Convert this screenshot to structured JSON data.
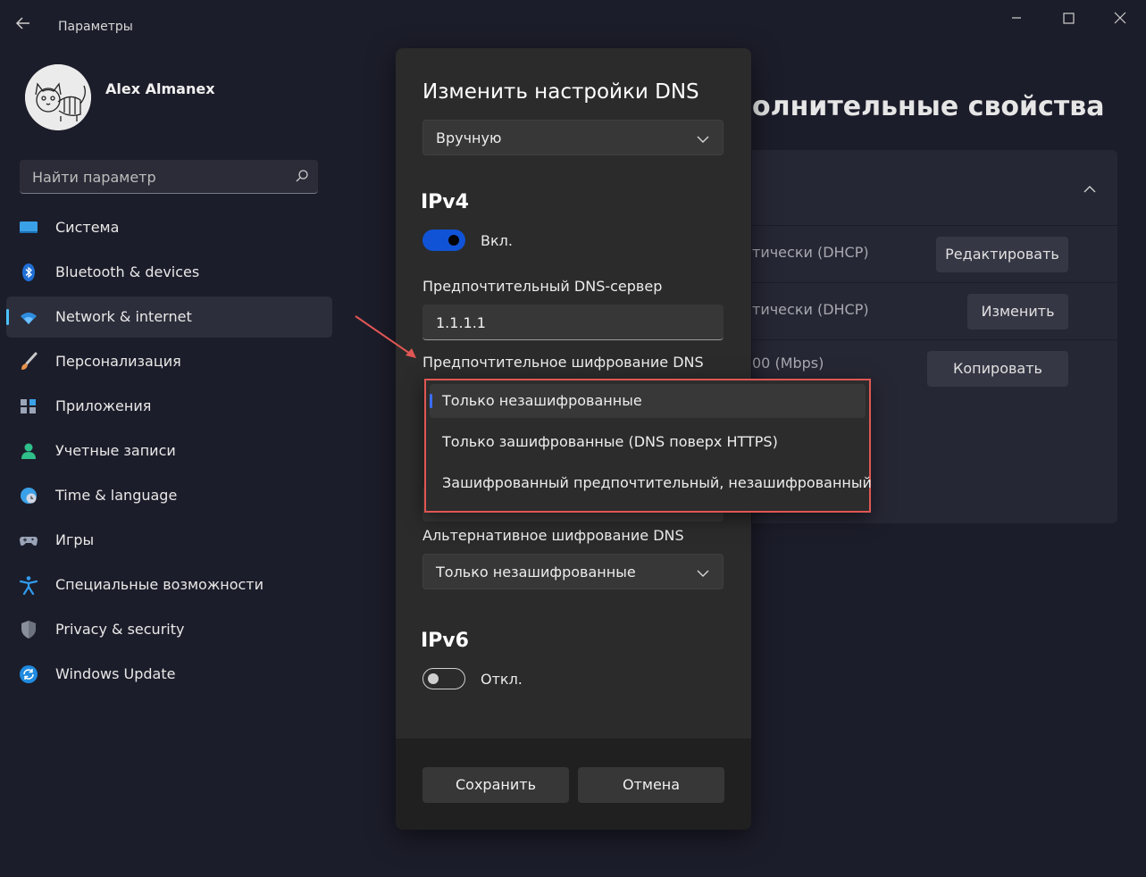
{
  "window": {
    "title": "Параметры",
    "controls": [
      "minimize-icon",
      "maximize-icon",
      "close-icon"
    ]
  },
  "user": {
    "name": "Alex Almanex"
  },
  "search": {
    "placeholder": "Найти параметр"
  },
  "sidebar": {
    "items": [
      {
        "label": "Система",
        "icon": "system-icon",
        "active": false
      },
      {
        "label": "Bluetooth & devices",
        "icon": "bluetooth-icon",
        "active": false
      },
      {
        "label": "Network & internet",
        "icon": "wifi-icon",
        "active": true
      },
      {
        "label": "Персонализация",
        "icon": "brush-icon",
        "active": false
      },
      {
        "label": "Приложения",
        "icon": "apps-icon",
        "active": false
      },
      {
        "label": "Учетные записи",
        "icon": "person-icon",
        "active": false
      },
      {
        "label": "Time & language",
        "icon": "globe-clock-icon",
        "active": false
      },
      {
        "label": "Игры",
        "icon": "gamepad-icon",
        "active": false
      },
      {
        "label": "Специальные возможности",
        "icon": "accessibility-icon",
        "active": false
      },
      {
        "label": "Privacy & security",
        "icon": "shield-icon",
        "active": false
      },
      {
        "label": "Windows Update",
        "icon": "update-icon",
        "active": false
      }
    ]
  },
  "main": {
    "heading": "олнительные свойства",
    "rows": [
      {
        "text": "тически (DHCP)",
        "button": "Редактировать"
      },
      {
        "text": "тически (DHCP)",
        "button": "Изменить"
      },
      {
        "text": "00 (Mbps)",
        "button": "Копировать"
      }
    ]
  },
  "dialog": {
    "title": "Изменить настройки DNS",
    "mode": "Вручную",
    "ipv4": {
      "title": "IPv4",
      "toggle_label": "Вкл.",
      "enabled": true,
      "preferred_dns_label": "Предпочтительный DNS-сервер",
      "preferred_dns_value": "1.1.1.1",
      "preferred_encryption_label": "Предпочтительное шифрование DNS",
      "alternate_encryption_label": "Альтернативное шифрование DNS",
      "alternate_encryption_value": "Только незашифрованные"
    },
    "ipv6": {
      "title": "IPv6",
      "toggle_label": "Откл.",
      "enabled": false
    },
    "save_label": "Сохранить",
    "cancel_label": "Отмена"
  },
  "encryption_dropdown": {
    "options": [
      "Только незашифрованные",
      "Только зашифрованные (DNS поверх HTTPS)",
      "Зашифрованный предпочтительный, незашифрованный"
    ],
    "selected": "Только незашифрованные"
  },
  "colors": {
    "accent": "#4cc2ff",
    "toggle_on": "#1053d6",
    "annotation": "#e05654",
    "background": "#1c1d2a",
    "dialog": "#2b2b2b"
  }
}
